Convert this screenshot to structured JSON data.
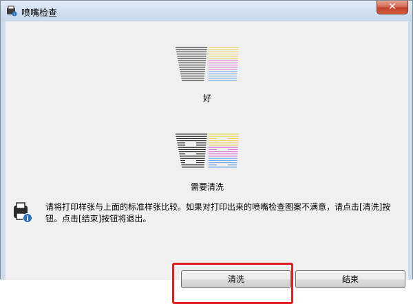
{
  "window": {
    "title": "喷嘴检查",
    "close_glyph": "✕"
  },
  "patterns": {
    "good": {
      "caption": "好"
    },
    "bad": {
      "caption": "需要清洗"
    }
  },
  "message": "请将打印样张与上面的标准样张比较。如果对打印出来的喷嘴检查图案不满意，请点击[清洗]按钮。点击[结束]按钮将退出。",
  "buttons": {
    "clean": "清洗",
    "end": "结束"
  },
  "icons": {
    "app": "printer-app-icon",
    "info": "info-printer-icon"
  },
  "colors": {
    "highlight": "#e02020",
    "black_ink": "#111111",
    "yellow_ink": "#e9d24a",
    "magenta_ink": "#d96fd0",
    "cyan_ink": "#5a9be6"
  }
}
